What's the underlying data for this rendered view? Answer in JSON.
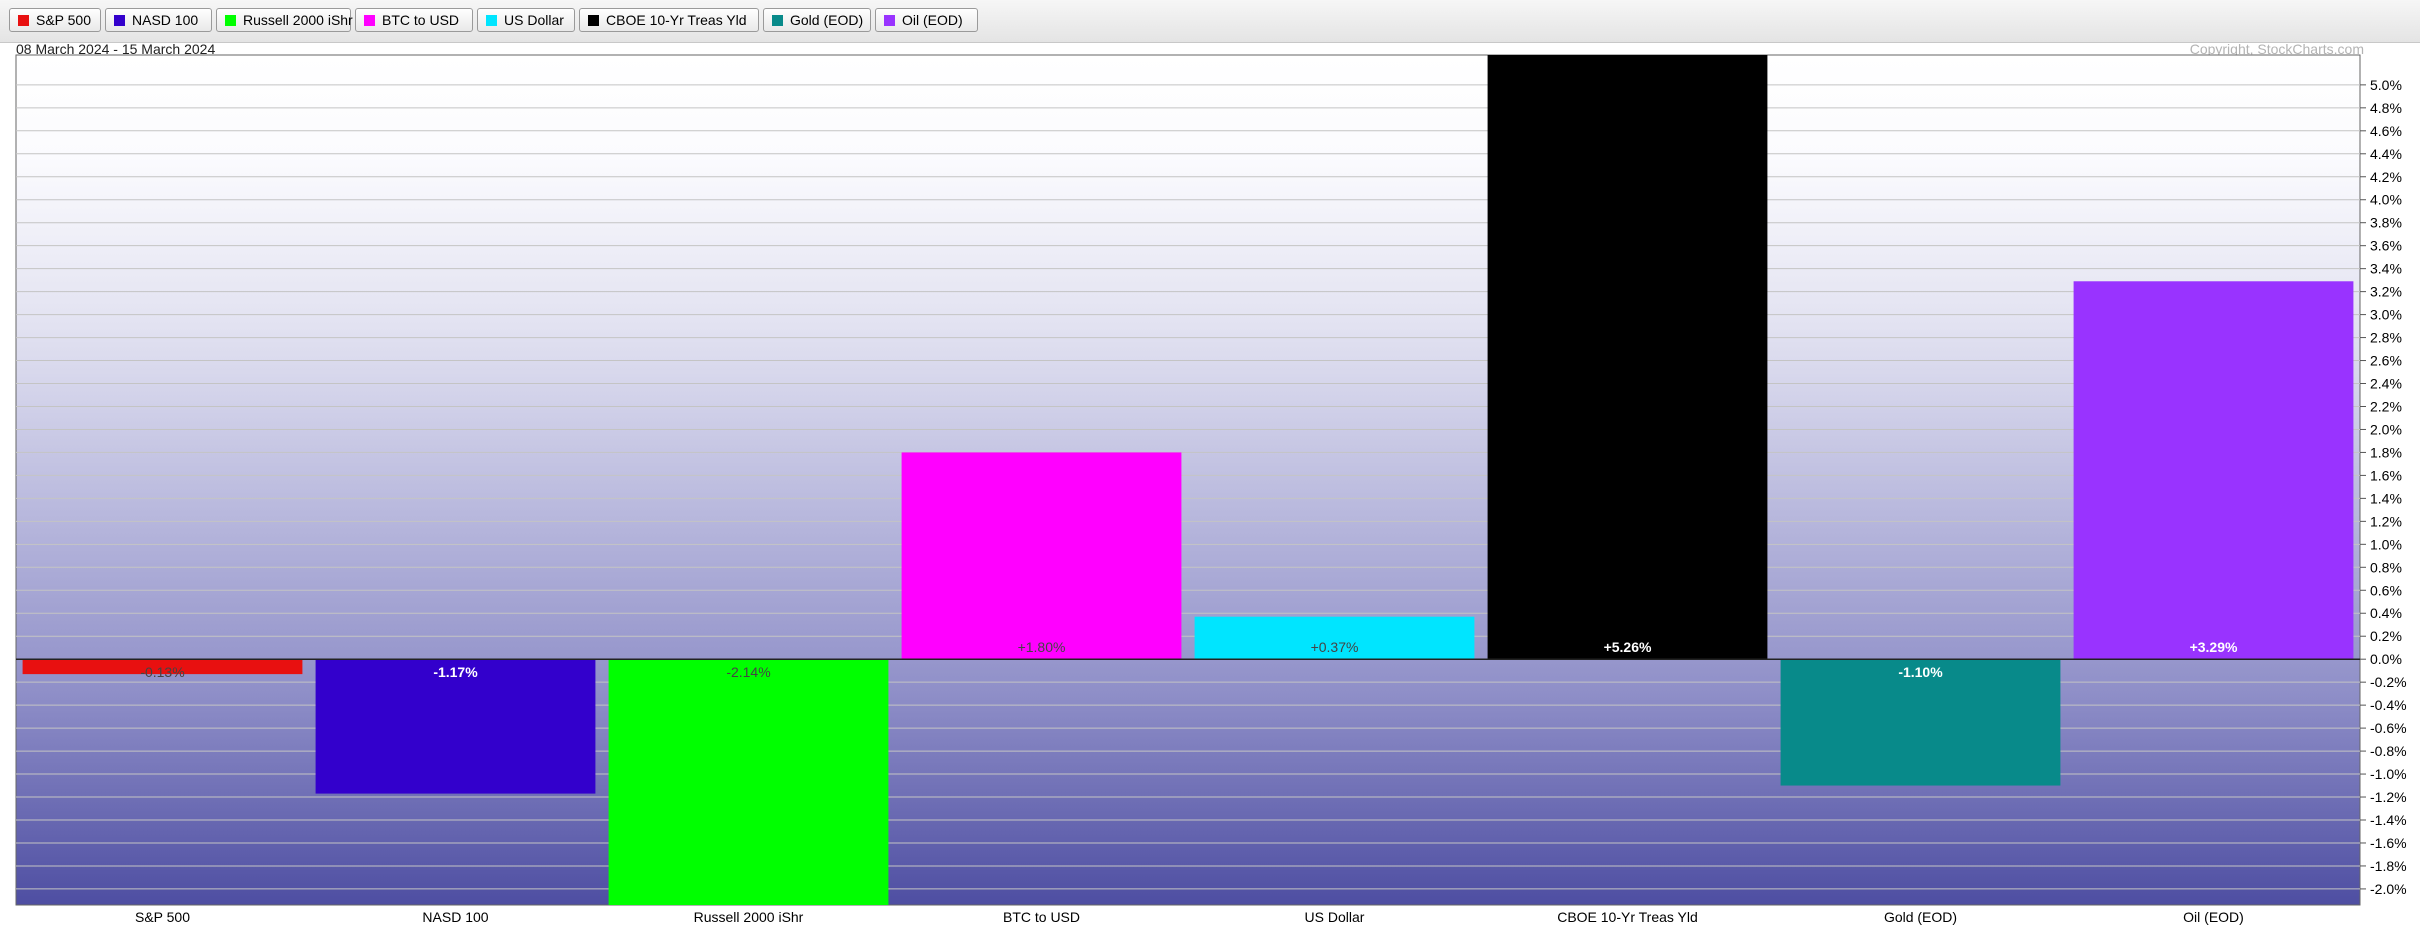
{
  "legend": [
    {
      "label": "S&P 500",
      "color": "#e81010"
    },
    {
      "label": "NASD 100",
      "color": "#3300cc"
    },
    {
      "label": "Russell 2000 iShr",
      "color": "#00ff00"
    },
    {
      "label": "BTC to USD",
      "color": "#ff00ff"
    },
    {
      "label": "US Dollar",
      "color": "#00e5ff"
    },
    {
      "label": "CBOE 10-Yr Treas Yld",
      "color": "#000000"
    },
    {
      "label": "Gold (EOD)",
      "color": "#088a8a"
    },
    {
      "label": "Oil (EOD)",
      "color": "#9933ff"
    }
  ],
  "date_range": "08 March 2024 - 15 March 2024",
  "copyright": "Copyright, StockCharts.com",
  "chart_data": {
    "type": "bar",
    "categories": [
      "S&P 500",
      "NASD 100",
      "Russell 2000 iShr",
      "BTC to USD",
      "US Dollar",
      "CBOE 10-Yr Treas Yld",
      "Gold (EOD)",
      "Oil (EOD)"
    ],
    "values": [
      -0.13,
      -1.17,
      -2.14,
      1.8,
      0.37,
      5.26,
      -1.1,
      3.29
    ],
    "data_labels": [
      "-0.13%",
      "-1.17%",
      "-2.14%",
      "+1.80%",
      "+0.37%",
      "+5.26%",
      "-1.10%",
      "+3.29%"
    ],
    "colors": [
      "#e81010",
      "#3300cc",
      "#00ff00",
      "#ff00ff",
      "#00e5ff",
      "#000000",
      "#088a8a",
      "#9933ff"
    ],
    "label_colors": [
      "#444444",
      "#ffffff",
      "#444444",
      "#444444",
      "#444444",
      "#ffffff",
      "#ffffff",
      "#ffffff"
    ],
    "yticks": [
      5.0,
      4.8,
      4.6,
      4.4,
      4.2,
      4.0,
      3.8,
      3.6,
      3.4,
      3.2,
      3.0,
      2.8,
      2.6,
      2.4,
      2.2,
      2.0,
      1.8,
      1.6,
      1.4,
      1.2,
      1.0,
      0.8,
      0.6,
      0.4,
      0.2,
      0.0,
      -0.2,
      -0.4,
      -0.6,
      -0.8,
      -1.0,
      -1.2,
      -1.4,
      -1.6,
      -1.8,
      -2.0
    ],
    "ytick_labels": [
      "5.0%",
      "4.8%",
      "4.6%",
      "4.4%",
      "4.2%",
      "4.0%",
      "3.8%",
      "3.6%",
      "3.4%",
      "3.2%",
      "3.0%",
      "2.8%",
      "2.6%",
      "2.4%",
      "2.2%",
      "2.0%",
      "1.8%",
      "1.6%",
      "1.4%",
      "1.2%",
      "1.0%",
      "0.8%",
      "0.6%",
      "0.4%",
      "0.2%",
      "0.0%",
      "-0.2%",
      "-0.4%",
      "-0.6%",
      "-0.8%",
      "-1.0%",
      "-1.2%",
      "-1.4%",
      "-1.6%",
      "-1.8%",
      "-2.0%"
    ],
    "ylim": [
      -2.14,
      5.26
    ],
    "grid": true,
    "legend_position": "top"
  }
}
